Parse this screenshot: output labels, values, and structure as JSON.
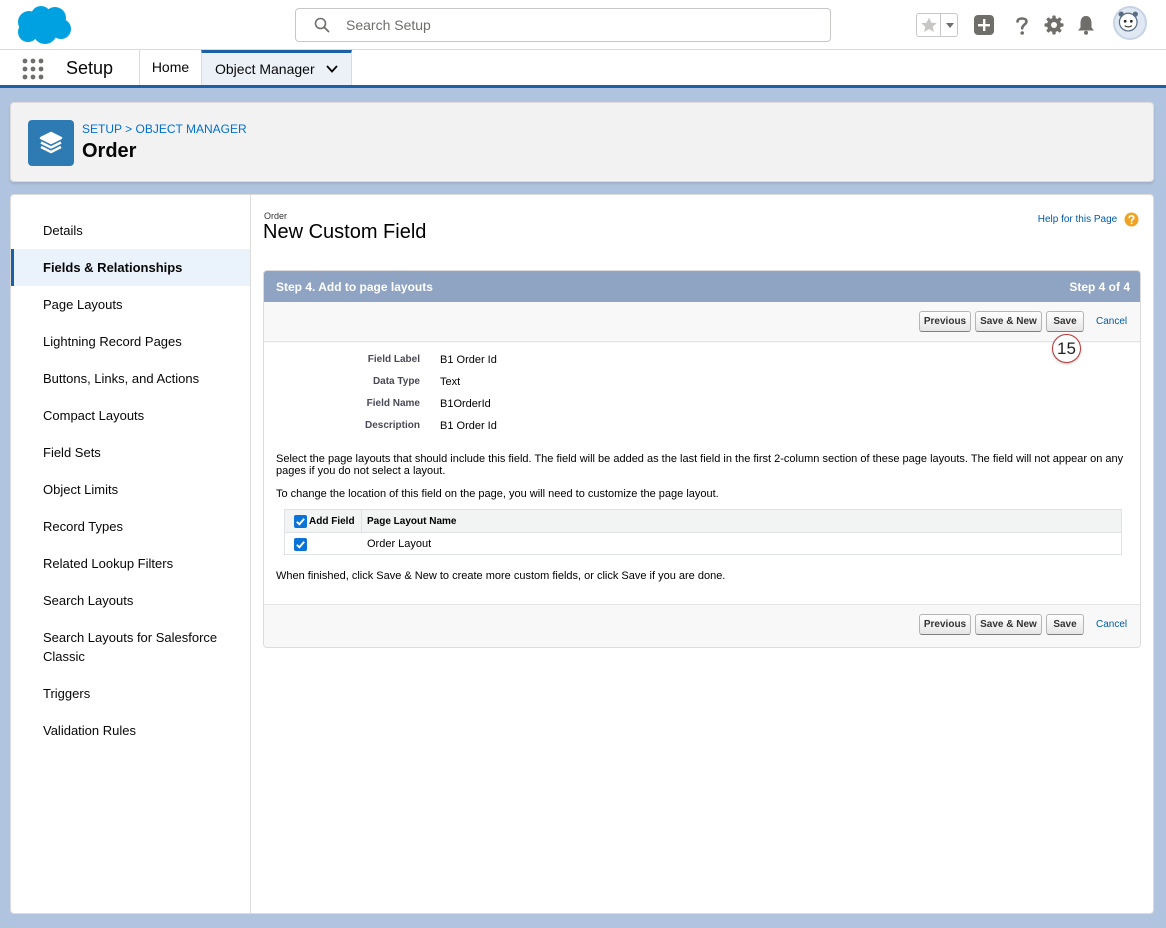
{
  "global_header": {
    "search_placeholder": "Search Setup"
  },
  "context_bar": {
    "app_name": "Setup",
    "tabs": [
      {
        "label": "Home"
      },
      {
        "label": "Object Manager"
      }
    ]
  },
  "record_header": {
    "breadcrumb": [
      "SETUP",
      ">",
      "OBJECT MANAGER"
    ],
    "title": "Order"
  },
  "sidebar": {
    "items": [
      {
        "label": "Details"
      },
      {
        "label": "Fields & Relationships",
        "active": true
      },
      {
        "label": "Page Layouts"
      },
      {
        "label": "Lightning Record Pages"
      },
      {
        "label": "Buttons, Links, and Actions"
      },
      {
        "label": "Compact Layouts"
      },
      {
        "label": "Field Sets"
      },
      {
        "label": "Object Limits"
      },
      {
        "label": "Record Types"
      },
      {
        "label": "Related Lookup Filters"
      },
      {
        "label": "Search Layouts"
      },
      {
        "label": "Search Layouts for Salesforce Classic"
      },
      {
        "label": "Triggers"
      },
      {
        "label": "Validation Rules"
      }
    ]
  },
  "content": {
    "object_type": "Order",
    "page_title": "New Custom Field",
    "help_link": "Help for this Page",
    "step_title": "Step 4. Add to page layouts",
    "step_count": "Step 4 of 4",
    "buttons": {
      "previous": "Previous",
      "save_new": "Save & New",
      "save": "Save",
      "cancel": "Cancel"
    },
    "fields": [
      {
        "label": "Field Label",
        "value": "B1 Order Id"
      },
      {
        "label": "Data Type",
        "value": "Text"
      },
      {
        "label": "Field Name",
        "value": "B1OrderId"
      },
      {
        "label": "Description",
        "value": "B1 Order Id"
      }
    ],
    "instruction_1": "Select the page layouts that should include this field. The field will be added as the last field in the first 2-column section of these page layouts. The field will not appear on any pages if you do not select a layout.",
    "instruction_2": "To change the location of this field on the page, you will need to customize the page layout.",
    "layout_table": {
      "headers": [
        "Add Field",
        "Page Layout Name"
      ],
      "rows": [
        {
          "checked": true,
          "name": "Order Layout"
        }
      ]
    },
    "finish_note": "When finished, click Save & New to create more custom fields, or click Save if you are done."
  },
  "callout": {
    "label": "15"
  },
  "colors": {
    "brand_blue": "#1b5fa5",
    "link": "#015ba7",
    "step_bar": "#8fa3c3",
    "object_icon": "#2e7bb4",
    "checkbox": "#0b72d8"
  }
}
